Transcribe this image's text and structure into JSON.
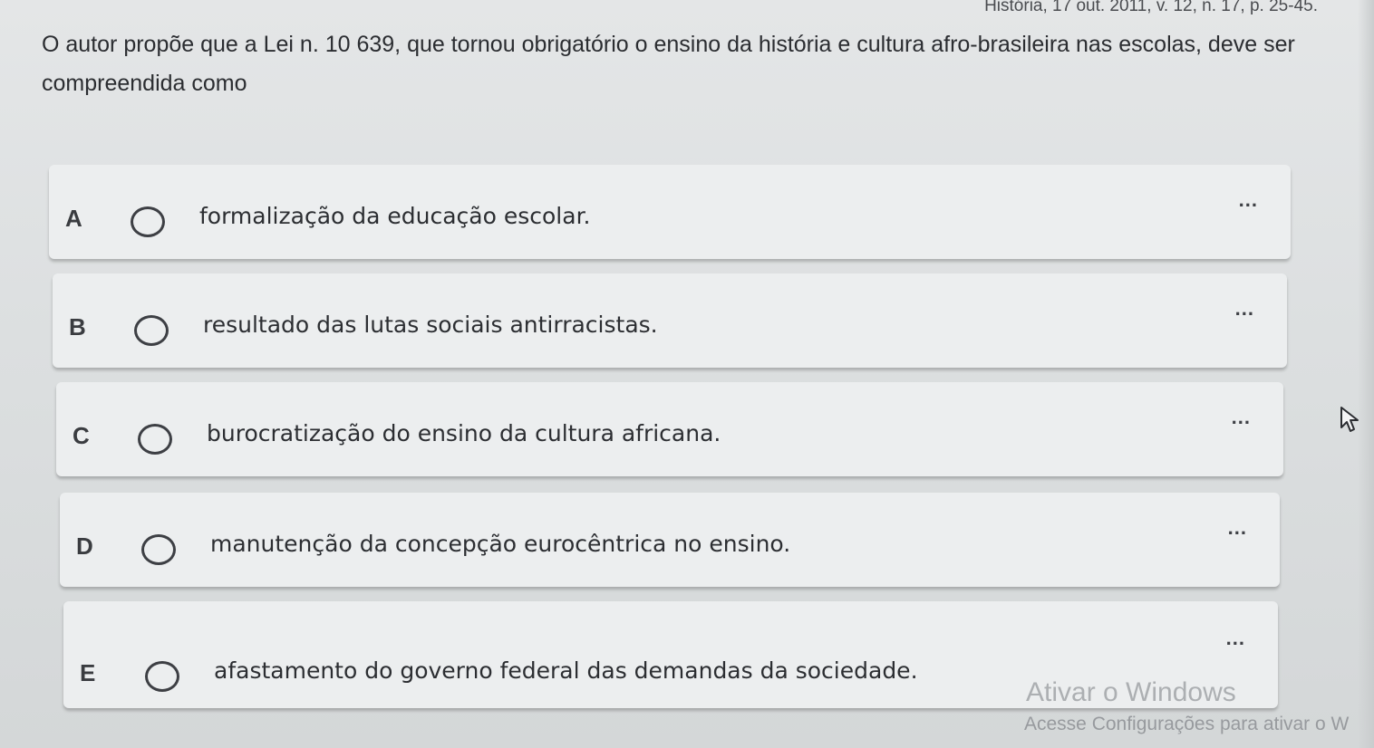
{
  "source_line": "História, 17 out. 2011, v. 12, n. 17, p. 25-45.",
  "question": {
    "text": "O autor propõe que a Lei n. 10 639, que tornou obrigatório o ensino da história e cultura afro-brasileira nas escolas, deve ser compreendida como"
  },
  "options": [
    {
      "letter": "A",
      "text": "formalização da educação escolar.",
      "more": "..."
    },
    {
      "letter": "B",
      "text": "resultado das lutas sociais antirracistas.",
      "more": "..."
    },
    {
      "letter": "C",
      "text": "burocratização do ensino da cultura africana.",
      "more": "..."
    },
    {
      "letter": "D",
      "text": "manutenção da concepção eurocêntrica no ensino.",
      "more": "..."
    },
    {
      "letter": "E",
      "text": "afastamento do governo federal das demandas da sociedade.",
      "more": "..."
    }
  ],
  "watermark": {
    "title": "Ativar o Windows",
    "subtitle": "Acesse Configurações para ativar o W"
  },
  "colors": {
    "background": "#dcdfe0",
    "card": "#eceeef",
    "text": "#2b2d31"
  }
}
